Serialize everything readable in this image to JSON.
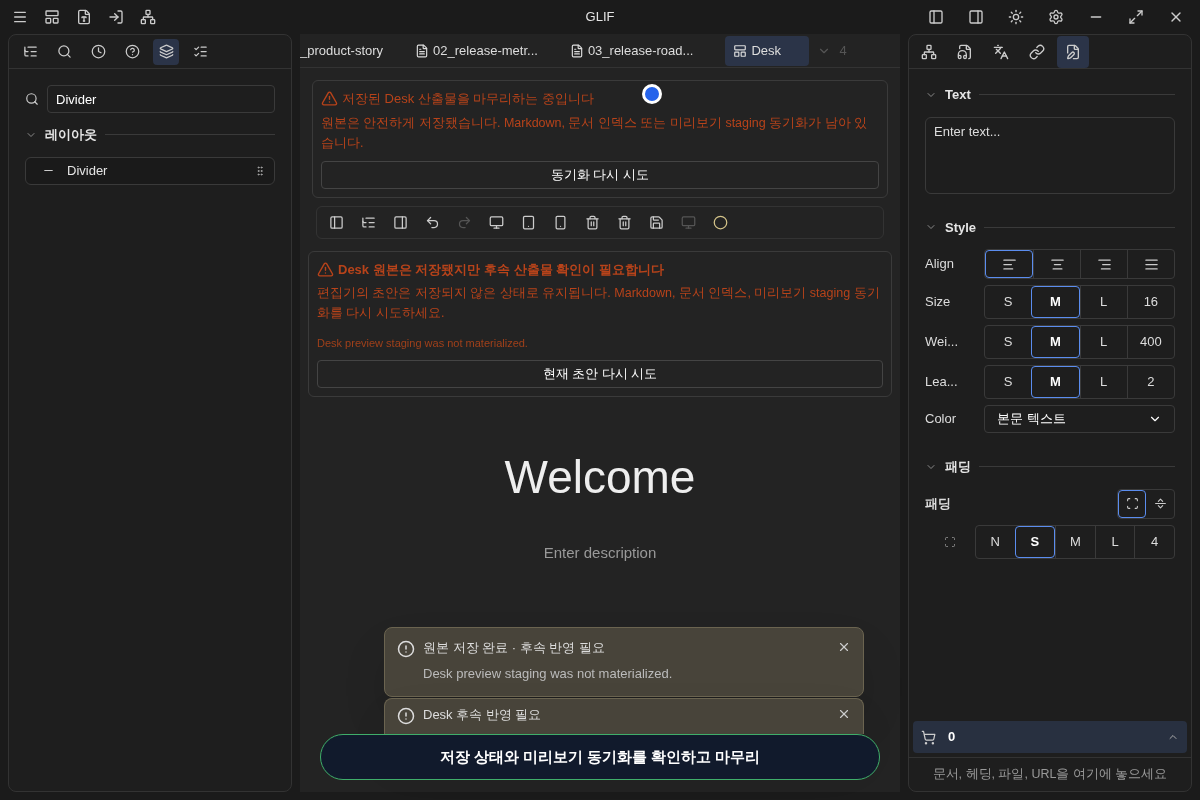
{
  "window": {
    "title": "GLIF"
  },
  "left_panel": {
    "tabs": [
      {
        "selected": false
      },
      {
        "selected": false
      },
      {
        "selected": false
      },
      {
        "selected": false
      },
      {
        "selected": true
      },
      {
        "selected": false
      }
    ],
    "search": {
      "value": "Divider"
    },
    "groups": [
      {
        "label": "레이아웃",
        "expanded": true,
        "items": [
          {
            "label": "Divider"
          }
        ]
      }
    ]
  },
  "doc_tabs": [
    {
      "label": "_product-story",
      "kind": "plain",
      "selected": false
    },
    {
      "label": "02_release-metr...",
      "kind": "doc",
      "selected": false
    },
    {
      "label": "03_release-road...",
      "kind": "doc",
      "selected": false
    },
    {
      "label": "Desk",
      "kind": "layout",
      "selected": true
    }
  ],
  "tab_overflow": "4",
  "alert_pending": {
    "title": "저장된 Desk 산출물을 마무리하는 중입니다",
    "body": "원본은 안전하게 저장됐습니다. Markdown, 문서 인덱스 또는 미리보기 staging 동기화가 남아 있습니다.",
    "button": "동기화 다시 시도"
  },
  "toolbar": [
    {
      "disabled": false
    },
    {
      "disabled": false
    },
    {
      "disabled": false
    },
    {
      "disabled": false
    },
    {
      "disabled": true
    },
    {
      "disabled": false
    },
    {
      "disabled": false
    },
    {
      "disabled": false
    },
    {
      "disabled": false
    },
    {
      "disabled": false
    },
    {
      "disabled": false
    },
    {
      "disabled": true
    },
    {
      "disabled": false
    }
  ],
  "alert_saved": {
    "title": "Desk 원본은 저장됐지만 후속 산출물 확인이 필요합니다",
    "body": "편집기의 초안은 저장되지 않은 상태로 유지됩니다. Markdown, 문서 인덱스, 미리보기 staging 동기화를 다시 시도하세요.",
    "detail": "Desk preview staging was not materialized.",
    "button": "현재 초안 다시 시도"
  },
  "canvas": {
    "heading": "Welcome",
    "description_placeholder": "Enter description"
  },
  "toasts": [
    {
      "title": "원본 저장 완료 · 후속 반영 필요",
      "body": "Desk preview staging was not materialized."
    },
    {
      "title": "Desk 후속 반영 필요"
    }
  ],
  "finish_button": "저장 상태와 미리보기 동기화를 확인하고 마무리",
  "right_panel": {
    "tabs": [
      {
        "selected": false
      },
      {
        "selected": false
      },
      {
        "selected": false
      },
      {
        "selected": false
      },
      {
        "selected": true
      }
    ],
    "text_section": {
      "title": "Text",
      "expanded": true,
      "placeholder": "Enter text..."
    },
    "style_section": {
      "title": "Style",
      "expanded": true,
      "align": {
        "label": "Align",
        "options": [
          {
            "selected": true
          },
          {
            "selected": false
          },
          {
            "selected": false
          },
          {
            "selected": false
          }
        ]
      },
      "rows": [
        {
          "label": "Size",
          "options": [
            {
              "label": "S",
              "selected": false
            },
            {
              "label": "M",
              "selected": true
            },
            {
              "label": "L",
              "selected": false
            },
            {
              "label": "16",
              "selected": false
            }
          ]
        },
        {
          "label": "Wei...",
          "options": [
            {
              "label": "S",
              "selected": false
            },
            {
              "label": "M",
              "selected": true
            },
            {
              "label": "L",
              "selected": false
            },
            {
              "label": "400",
              "selected": false
            }
          ]
        },
        {
          "label": "Lea...",
          "options": [
            {
              "label": "S",
              "selected": false
            },
            {
              "label": "M",
              "selected": true
            },
            {
              "label": "L",
              "selected": false
            },
            {
              "label": "2",
              "selected": false
            }
          ]
        }
      ],
      "color": {
        "label": "Color",
        "value": "본문 텍스트"
      }
    },
    "padding_section": {
      "title": "패딩",
      "expanded": true,
      "label": "패딩",
      "modes": [
        {
          "selected": true
        },
        {
          "selected": false
        }
      ],
      "options": [
        {
          "label": "N",
          "selected": false
        },
        {
          "label": "S",
          "selected": true
        },
        {
          "label": "M",
          "selected": false
        },
        {
          "label": "L",
          "selected": false
        },
        {
          "label": "4",
          "selected": false
        }
      ]
    },
    "cart": {
      "count": "0",
      "hint": "문서, 헤딩, 파일, URL을 여기에 놓으세요"
    }
  }
}
